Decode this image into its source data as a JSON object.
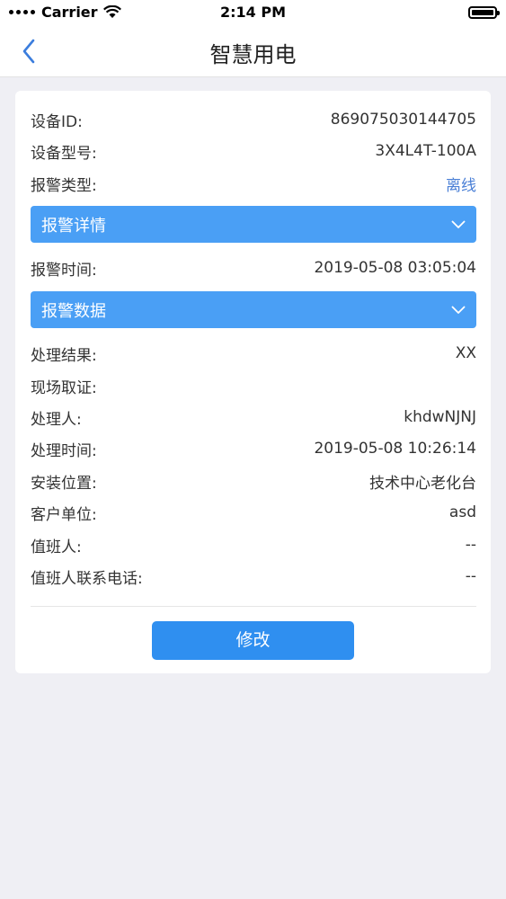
{
  "status_bar": {
    "carrier": "Carrier",
    "time": "2:14 PM"
  },
  "nav": {
    "title": "智慧用电"
  },
  "fields": {
    "device_id": {
      "label": "设备ID:",
      "value": "869075030144705"
    },
    "device_model": {
      "label": "设备型号:",
      "value": "3X4L4T-100A"
    },
    "alarm_type": {
      "label": "报警类型:",
      "value": "离线"
    },
    "alarm_time": {
      "label": "报警时间:",
      "value": "2019-05-08 03:05:04"
    },
    "result": {
      "label": "处理结果:",
      "value": "XX"
    },
    "evidence": {
      "label": "现场取证:",
      "value": ""
    },
    "handler": {
      "label": "处理人:",
      "value": "khdwNJNJ"
    },
    "handle_time": {
      "label": "处理时间:",
      "value": "2019-05-08 10:26:14"
    },
    "install_location": {
      "label": "安装位置:",
      "value": "技术中心老化台"
    },
    "customer_unit": {
      "label": "客户单位:",
      "value": "asd"
    },
    "on_duty": {
      "label": "值班人:",
      "value": "--"
    },
    "on_duty_phone": {
      "label": "值班人联系电话:",
      "value": "--"
    }
  },
  "dropdowns": {
    "alarm_detail": "报警详情",
    "alarm_data": "报警数据"
  },
  "actions": {
    "edit_label": "修改"
  },
  "colors": {
    "dropdown_bg": "#4a9ff5",
    "button_bg": "#2f8ff0",
    "link": "#4a7fd6",
    "back_chevron": "#3b7ddd"
  }
}
